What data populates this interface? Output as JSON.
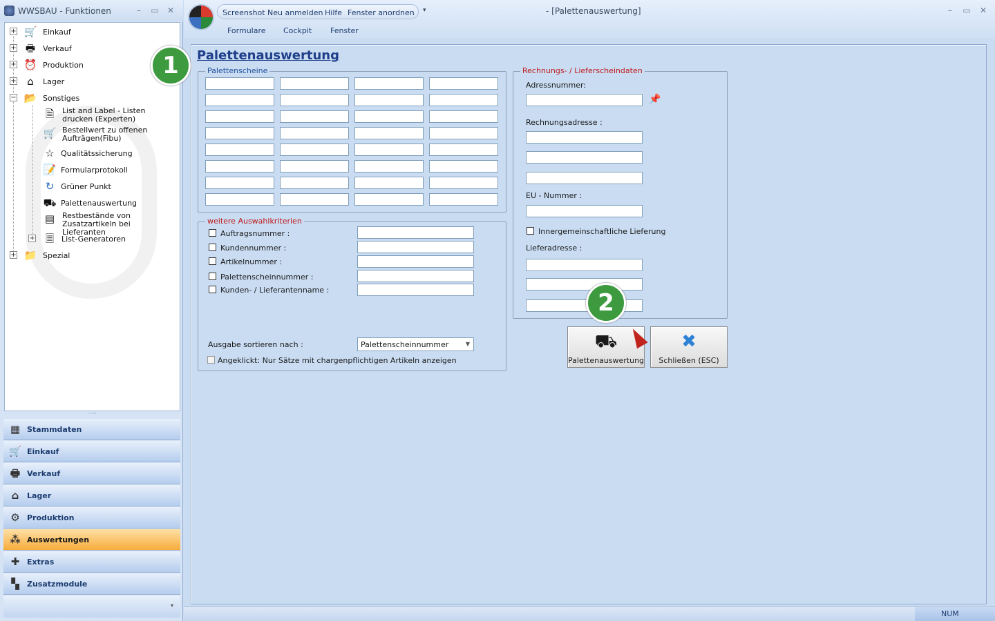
{
  "left_window": {
    "title": "WWSBAU - Funktionen",
    "tree": [
      {
        "label": "Einkauf",
        "icon": "cart-icon"
      },
      {
        "label": "Verkauf",
        "icon": "register-icon"
      },
      {
        "label": "Produktion",
        "icon": "clock-icon"
      },
      {
        "label": "Lager",
        "icon": "warehouse-icon"
      },
      {
        "label": "Sonstiges",
        "icon": "folder-open-icon"
      },
      {
        "label": "List and Label - Listen drucken (Experten)",
        "icon": "document-icon"
      },
      {
        "label": "Bestellwert zu offenen Aufträgen(Fibu)",
        "icon": "cart-info-icon"
      },
      {
        "label": "Qualitätssicherung",
        "icon": "star-icon"
      },
      {
        "label": "Formularprotokoll",
        "icon": "form-icon"
      },
      {
        "label": "Grüner Punkt",
        "icon": "recycle-icon"
      },
      {
        "label": "Palettenauswertung",
        "icon": "pallet-icon"
      },
      {
        "label": "Restbestände von Zusatzartikeln bei Lieferanten",
        "icon": "stock-icon"
      },
      {
        "label": "List-Generatoren",
        "icon": "list-icon"
      },
      {
        "label": "Spezial",
        "icon": "folder-icon"
      }
    ],
    "nav": [
      {
        "label": "Stammdaten",
        "icon": "master-data-icon"
      },
      {
        "label": "Einkauf",
        "icon": "cart-icon"
      },
      {
        "label": "Verkauf",
        "icon": "register-icon"
      },
      {
        "label": "Lager",
        "icon": "warehouse-icon"
      },
      {
        "label": "Produktion",
        "icon": "production-icon"
      },
      {
        "label": "Auswertungen",
        "icon": "analytics-icon",
        "active": true
      },
      {
        "label": "Extras",
        "icon": "puzzle-icon"
      },
      {
        "label": "Zusatzmodule",
        "icon": "modules-icon"
      }
    ]
  },
  "main_window": {
    "quick_access": [
      "Screenshot",
      "Neu anmelden",
      "Hilfe",
      "Fenster anordnen"
    ],
    "title": "- [Palettenauswertung]",
    "menu_tabs": [
      "Formulare",
      "Cockpit",
      "Fenster"
    ]
  },
  "form": {
    "title": "Palettenauswertung",
    "palettenscheine": {
      "label": "Palettenscheine"
    },
    "criteria": {
      "label": "weitere Auswahlkriterien",
      "items": [
        "Auftragsnummer :",
        "Kundennummer :",
        "Artikelnummer :",
        "Palettenscheinnummer :",
        "Kunden- / Lieferantenname :"
      ],
      "sort_label": "Ausgabe sortieren nach :",
      "sort_value": "Palettenscheinnummer",
      "charge_label": "Angeklickt: Nur Sätze mit chargenpflichtigen Artikeln anzeigen"
    },
    "rechnung": {
      "label": "Rechnungs- / Lieferscheindaten",
      "adressnummer": "Adressnummer:",
      "rechnungsadresse": "Rechnungsadresse :",
      "eu_nummer": "EU - Nummer :",
      "innergemeinschaftlich": "Innergemeinschaftliche Lieferung",
      "lieferadresse": "Lieferadresse :"
    },
    "buttons": {
      "run": "Palettenauswertung",
      "close": "Schließen (ESC)"
    },
    "badges": [
      "1",
      "2"
    ]
  },
  "statusbar": {
    "num": "NUM"
  }
}
